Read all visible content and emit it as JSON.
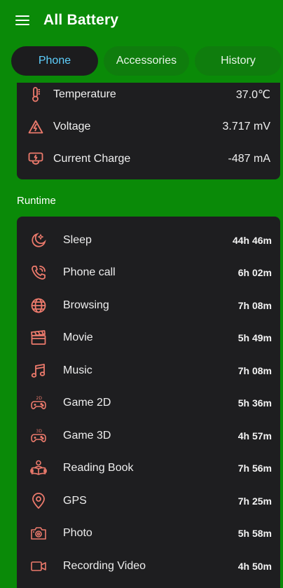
{
  "app": {
    "title": "All Battery",
    "accent": "#ec7a6c",
    "background": "#0a8a08"
  },
  "tabs": [
    {
      "label": "Phone",
      "active": true
    },
    {
      "label": "Accessories",
      "active": false
    },
    {
      "label": "History",
      "active": false
    }
  ],
  "info": [
    {
      "icon": "thermometer-icon",
      "label": "Temperature",
      "value": "37.0℃"
    },
    {
      "icon": "voltage-icon",
      "label": "Voltage",
      "value": "3.717 mV"
    },
    {
      "icon": "charger-icon",
      "label": "Current Charge",
      "value": "-487 mA"
    }
  ],
  "runtime": {
    "section_label": "Runtime",
    "items": [
      {
        "icon": "sleep-icon",
        "label": "Sleep",
        "value": "44h 46m"
      },
      {
        "icon": "phone-call-icon",
        "label": "Phone call",
        "value": "6h 02m"
      },
      {
        "icon": "globe-icon",
        "label": "Browsing",
        "value": "7h 08m"
      },
      {
        "icon": "clapperboard-icon",
        "label": "Movie",
        "value": "5h 49m"
      },
      {
        "icon": "music-note-icon",
        "label": "Music",
        "value": "7h 08m"
      },
      {
        "icon": "gamepad-2d-icon",
        "label": "Game 2D",
        "value": "5h 36m"
      },
      {
        "icon": "gamepad-3d-icon",
        "label": "Game 3D",
        "value": "4h 57m"
      },
      {
        "icon": "reading-book-icon",
        "label": "Reading Book",
        "value": "7h 56m"
      },
      {
        "icon": "location-pin-icon",
        "label": "GPS",
        "value": "7h 25m"
      },
      {
        "icon": "camera-icon",
        "label": "Photo",
        "value": "5h 58m"
      },
      {
        "icon": "video-camera-icon",
        "label": "Recording Video",
        "value": "4h 50m"
      }
    ]
  }
}
